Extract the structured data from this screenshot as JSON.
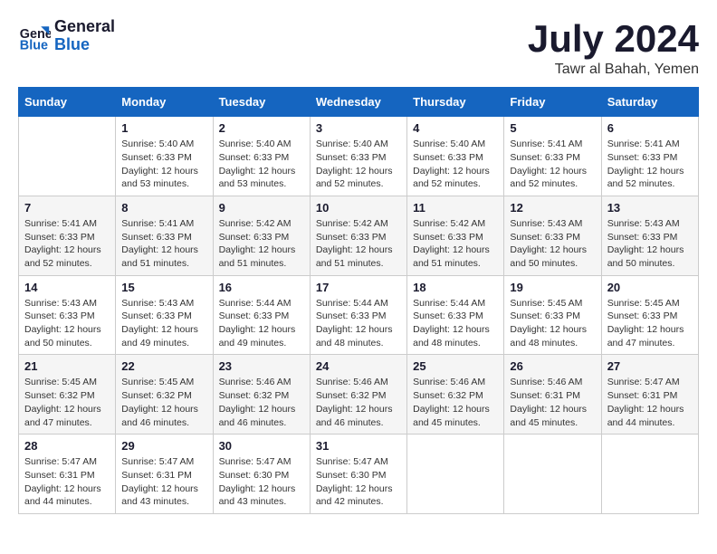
{
  "logo": {
    "text_general": "General",
    "text_blue": "Blue"
  },
  "title": "July 2024",
  "subtitle": "Tawr al Bahah, Yemen",
  "days_header": [
    "Sunday",
    "Monday",
    "Tuesday",
    "Wednesday",
    "Thursday",
    "Friday",
    "Saturday"
  ],
  "weeks": [
    [
      {
        "day": "",
        "info": ""
      },
      {
        "day": "1",
        "info": "Sunrise: 5:40 AM\nSunset: 6:33 PM\nDaylight: 12 hours\nand 53 minutes."
      },
      {
        "day": "2",
        "info": "Sunrise: 5:40 AM\nSunset: 6:33 PM\nDaylight: 12 hours\nand 53 minutes."
      },
      {
        "day": "3",
        "info": "Sunrise: 5:40 AM\nSunset: 6:33 PM\nDaylight: 12 hours\nand 52 minutes."
      },
      {
        "day": "4",
        "info": "Sunrise: 5:40 AM\nSunset: 6:33 PM\nDaylight: 12 hours\nand 52 minutes."
      },
      {
        "day": "5",
        "info": "Sunrise: 5:41 AM\nSunset: 6:33 PM\nDaylight: 12 hours\nand 52 minutes."
      },
      {
        "day": "6",
        "info": "Sunrise: 5:41 AM\nSunset: 6:33 PM\nDaylight: 12 hours\nand 52 minutes."
      }
    ],
    [
      {
        "day": "7",
        "info": "Sunrise: 5:41 AM\nSunset: 6:33 PM\nDaylight: 12 hours\nand 52 minutes."
      },
      {
        "day": "8",
        "info": "Sunrise: 5:41 AM\nSunset: 6:33 PM\nDaylight: 12 hours\nand 51 minutes."
      },
      {
        "day": "9",
        "info": "Sunrise: 5:42 AM\nSunset: 6:33 PM\nDaylight: 12 hours\nand 51 minutes."
      },
      {
        "day": "10",
        "info": "Sunrise: 5:42 AM\nSunset: 6:33 PM\nDaylight: 12 hours\nand 51 minutes."
      },
      {
        "day": "11",
        "info": "Sunrise: 5:42 AM\nSunset: 6:33 PM\nDaylight: 12 hours\nand 51 minutes."
      },
      {
        "day": "12",
        "info": "Sunrise: 5:43 AM\nSunset: 6:33 PM\nDaylight: 12 hours\nand 50 minutes."
      },
      {
        "day": "13",
        "info": "Sunrise: 5:43 AM\nSunset: 6:33 PM\nDaylight: 12 hours\nand 50 minutes."
      }
    ],
    [
      {
        "day": "14",
        "info": "Sunrise: 5:43 AM\nSunset: 6:33 PM\nDaylight: 12 hours\nand 50 minutes."
      },
      {
        "day": "15",
        "info": "Sunrise: 5:43 AM\nSunset: 6:33 PM\nDaylight: 12 hours\nand 49 minutes."
      },
      {
        "day": "16",
        "info": "Sunrise: 5:44 AM\nSunset: 6:33 PM\nDaylight: 12 hours\nand 49 minutes."
      },
      {
        "day": "17",
        "info": "Sunrise: 5:44 AM\nSunset: 6:33 PM\nDaylight: 12 hours\nand 48 minutes."
      },
      {
        "day": "18",
        "info": "Sunrise: 5:44 AM\nSunset: 6:33 PM\nDaylight: 12 hours\nand 48 minutes."
      },
      {
        "day": "19",
        "info": "Sunrise: 5:45 AM\nSunset: 6:33 PM\nDaylight: 12 hours\nand 48 minutes."
      },
      {
        "day": "20",
        "info": "Sunrise: 5:45 AM\nSunset: 6:33 PM\nDaylight: 12 hours\nand 47 minutes."
      }
    ],
    [
      {
        "day": "21",
        "info": "Sunrise: 5:45 AM\nSunset: 6:32 PM\nDaylight: 12 hours\nand 47 minutes."
      },
      {
        "day": "22",
        "info": "Sunrise: 5:45 AM\nSunset: 6:32 PM\nDaylight: 12 hours\nand 46 minutes."
      },
      {
        "day": "23",
        "info": "Sunrise: 5:46 AM\nSunset: 6:32 PM\nDaylight: 12 hours\nand 46 minutes."
      },
      {
        "day": "24",
        "info": "Sunrise: 5:46 AM\nSunset: 6:32 PM\nDaylight: 12 hours\nand 46 minutes."
      },
      {
        "day": "25",
        "info": "Sunrise: 5:46 AM\nSunset: 6:32 PM\nDaylight: 12 hours\nand 45 minutes."
      },
      {
        "day": "26",
        "info": "Sunrise: 5:46 AM\nSunset: 6:31 PM\nDaylight: 12 hours\nand 45 minutes."
      },
      {
        "day": "27",
        "info": "Sunrise: 5:47 AM\nSunset: 6:31 PM\nDaylight: 12 hours\nand 44 minutes."
      }
    ],
    [
      {
        "day": "28",
        "info": "Sunrise: 5:47 AM\nSunset: 6:31 PM\nDaylight: 12 hours\nand 44 minutes."
      },
      {
        "day": "29",
        "info": "Sunrise: 5:47 AM\nSunset: 6:31 PM\nDaylight: 12 hours\nand 43 minutes."
      },
      {
        "day": "30",
        "info": "Sunrise: 5:47 AM\nSunset: 6:30 PM\nDaylight: 12 hours\nand 43 minutes."
      },
      {
        "day": "31",
        "info": "Sunrise: 5:47 AM\nSunset: 6:30 PM\nDaylight: 12 hours\nand 42 minutes."
      },
      {
        "day": "",
        "info": ""
      },
      {
        "day": "",
        "info": ""
      },
      {
        "day": "",
        "info": ""
      }
    ]
  ]
}
